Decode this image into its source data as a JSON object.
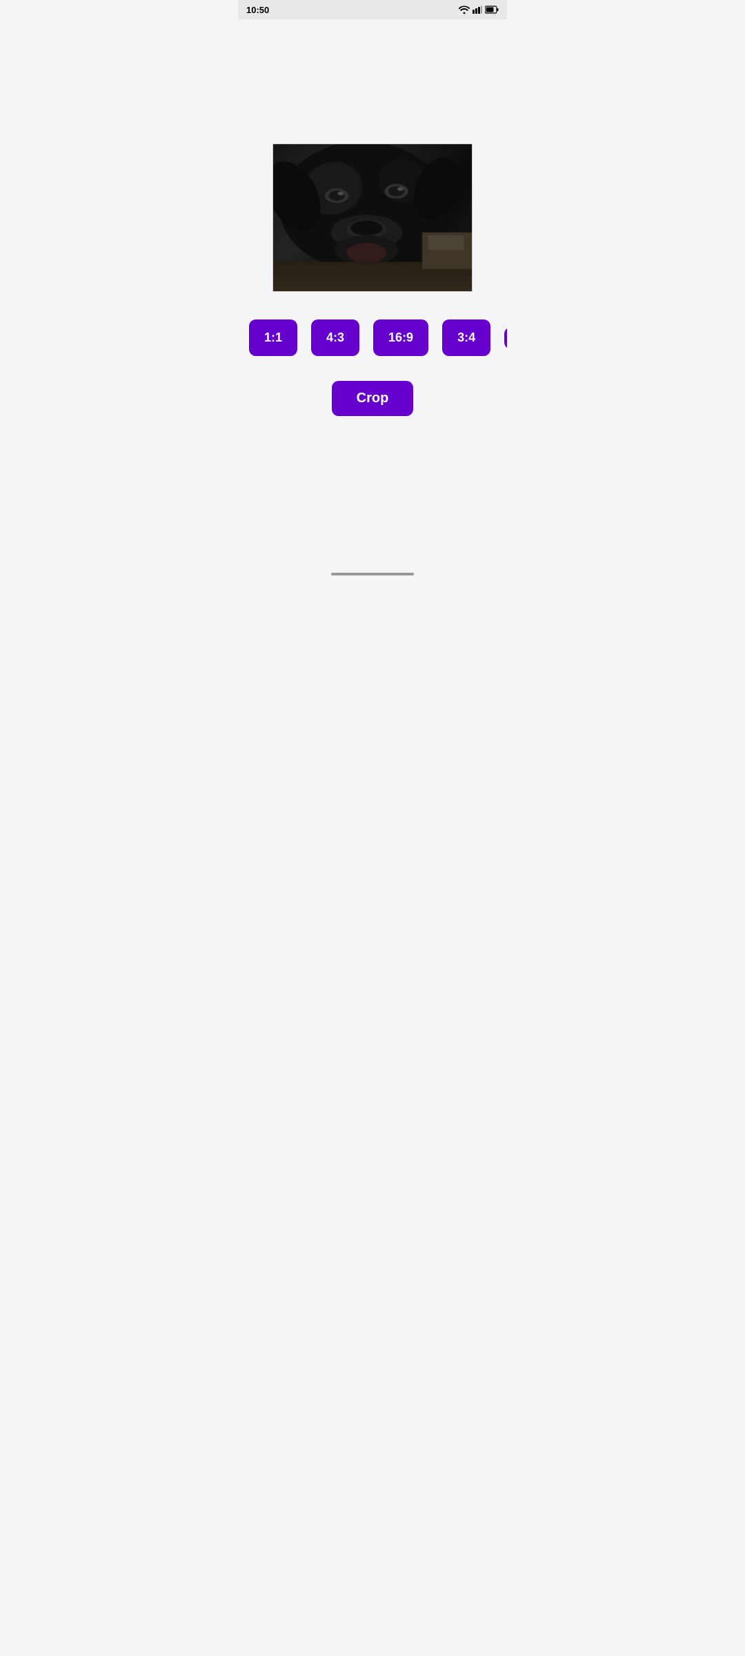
{
  "statusBar": {
    "time": "10:50"
  },
  "ratioButtons": [
    {
      "label": "1:1",
      "id": "ratio-1-1"
    },
    {
      "label": "4:3",
      "id": "ratio-4-3"
    },
    {
      "label": "16:9",
      "id": "ratio-16-9"
    },
    {
      "label": "3:4",
      "id": "ratio-3-4"
    },
    {
      "label": "",
      "id": "ratio-extra",
      "partial": true
    }
  ],
  "cropButton": {
    "label": "Crop"
  },
  "colors": {
    "buttonBg": "#6600cc",
    "buttonText": "#ffffff",
    "pageBg": "#f5f5f7"
  }
}
